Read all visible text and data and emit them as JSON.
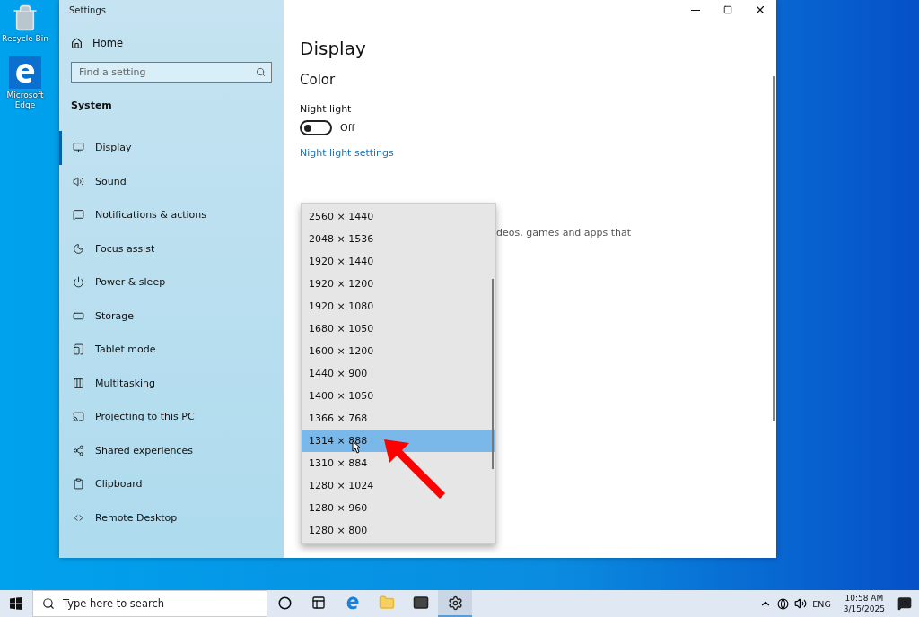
{
  "desktop_icons": [
    {
      "label": "Recycle Bin",
      "kind": "recycle"
    },
    {
      "label": "Microsoft Edge",
      "kind": "edge"
    }
  ],
  "window": {
    "title": "Settings"
  },
  "sidebar": {
    "home": "Home",
    "search": {
      "placeholder": "Find a setting"
    },
    "section": "System",
    "items": [
      {
        "label": "Display",
        "selected": true
      },
      {
        "label": "Sound",
        "selected": false
      },
      {
        "label": "Notifications & actions",
        "selected": false
      },
      {
        "label": "Focus assist",
        "selected": false
      },
      {
        "label": "Power & sleep",
        "selected": false
      },
      {
        "label": "Storage",
        "selected": false
      },
      {
        "label": "Tablet mode",
        "selected": false
      },
      {
        "label": "Multitasking",
        "selected": false
      },
      {
        "label": "Projecting to this PC",
        "selected": false
      },
      {
        "label": "Shared experiences",
        "selected": false
      },
      {
        "label": "Clipboard",
        "selected": false
      },
      {
        "label": "Remote Desktop",
        "selected": false
      }
    ]
  },
  "content": {
    "title": "Display",
    "section": "Color",
    "night_light": {
      "label": "Night light",
      "on": false,
      "state": "Off"
    },
    "link": "Night light settings",
    "covered_text": "deos, games and apps that"
  },
  "resolution_dropdown": {
    "options": [
      {
        "label": "2560 × 1440",
        "selected": false
      },
      {
        "label": "2048 × 1536",
        "selected": false
      },
      {
        "label": "1920 × 1440",
        "selected": false
      },
      {
        "label": "1920 × 1200",
        "selected": false
      },
      {
        "label": "1920 × 1080",
        "selected": false
      },
      {
        "label": "1680 × 1050",
        "selected": false
      },
      {
        "label": "1600 × 1200",
        "selected": false
      },
      {
        "label": "1440 × 900",
        "selected": false
      },
      {
        "label": "1400 × 1050",
        "selected": false
      },
      {
        "label": "1366 × 768",
        "selected": false
      },
      {
        "label": "1314 × 888",
        "selected": true
      },
      {
        "label": "1310 × 884",
        "selected": false
      },
      {
        "label": "1280 × 1024",
        "selected": false
      },
      {
        "label": "1280 × 960",
        "selected": false
      },
      {
        "label": "1280 × 800",
        "selected": false
      }
    ]
  },
  "taskbar": {
    "search": {
      "placeholder": "Type here to search"
    },
    "apps": [
      {
        "kind": "cortana",
        "selected": false
      },
      {
        "kind": "taskview",
        "selected": false
      },
      {
        "kind": "edge",
        "selected": false
      },
      {
        "kind": "explorer",
        "selected": false
      },
      {
        "kind": "mail",
        "selected": false
      },
      {
        "kind": "settings",
        "selected": true
      }
    ],
    "language": "ENG",
    "time": "10:58 AM",
    "date": "3/15/2025"
  }
}
